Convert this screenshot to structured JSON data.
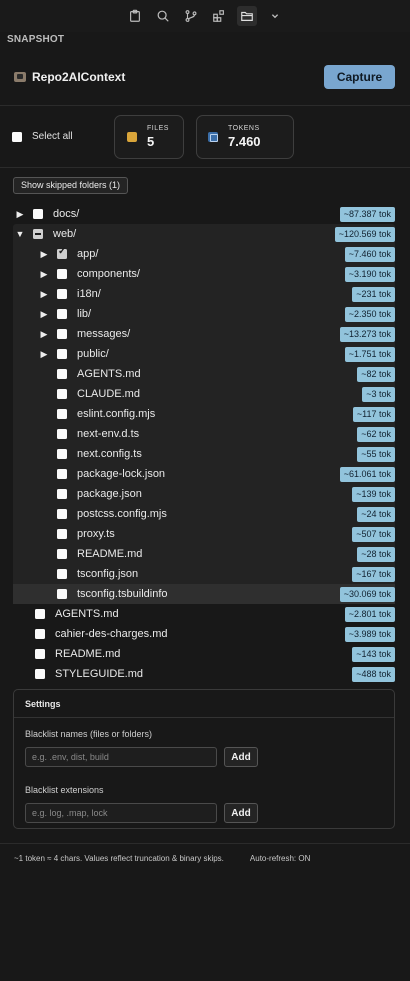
{
  "activity_bar": {
    "icons": [
      "clipboard-icon",
      "search-icon",
      "source-control-icon",
      "extensions-icon",
      "folder-panel-icon",
      "chevron-down-icon"
    ]
  },
  "section": {
    "title": "SNAPSHOT"
  },
  "header": {
    "app_name": "Repo2AIContext",
    "capture_label": "Capture"
  },
  "stats": {
    "select_all_label": "Select all",
    "files_label": "FILES",
    "files_value": "5",
    "tokens_label": "TOKENS",
    "tokens_value": "7.460"
  },
  "skip_button": "Show skipped folders (1)",
  "tree": {
    "top": [
      {
        "name": "docs/",
        "tokens": "~87.387 tok",
        "arrow": "▶",
        "state": "unchecked"
      }
    ],
    "web": {
      "name": "web/",
      "tokens": "~120.569 tok",
      "arrow": "▼",
      "state": "indeterminate"
    },
    "web_children": [
      {
        "name": "app/",
        "tokens": "~7.460 tok",
        "arrow": "▶",
        "state": "checked"
      },
      {
        "name": "components/",
        "tokens": "~3.190 tok",
        "arrow": "▶",
        "state": "unchecked"
      },
      {
        "name": "i18n/",
        "tokens": "~231 tok",
        "arrow": "▶",
        "state": "unchecked"
      },
      {
        "name": "lib/",
        "tokens": "~2.350 tok",
        "arrow": "▶",
        "state": "unchecked"
      },
      {
        "name": "messages/",
        "tokens": "~13.273 tok",
        "arrow": "▶",
        "state": "unchecked"
      },
      {
        "name": "public/",
        "tokens": "~1.751 tok",
        "arrow": "▶",
        "state": "unchecked"
      },
      {
        "name": "AGENTS.md",
        "tokens": "~82 tok",
        "arrow": "",
        "state": "unchecked"
      },
      {
        "name": "CLAUDE.md",
        "tokens": "~3 tok",
        "arrow": "",
        "state": "unchecked"
      },
      {
        "name": "eslint.config.mjs",
        "tokens": "~117 tok",
        "arrow": "",
        "state": "unchecked"
      },
      {
        "name": "next-env.d.ts",
        "tokens": "~62 tok",
        "arrow": "",
        "state": "unchecked"
      },
      {
        "name": "next.config.ts",
        "tokens": "~55 tok",
        "arrow": "",
        "state": "unchecked"
      },
      {
        "name": "package-lock.json",
        "tokens": "~61.061 tok",
        "arrow": "",
        "state": "unchecked"
      },
      {
        "name": "package.json",
        "tokens": "~139 tok",
        "arrow": "",
        "state": "unchecked"
      },
      {
        "name": "postcss.config.mjs",
        "tokens": "~24 tok",
        "arrow": "",
        "state": "unchecked"
      },
      {
        "name": "proxy.ts",
        "tokens": "~507 tok",
        "arrow": "",
        "state": "unchecked"
      },
      {
        "name": "README.md",
        "tokens": "~28 tok",
        "arrow": "",
        "state": "unchecked"
      },
      {
        "name": "tsconfig.json",
        "tokens": "~167 tok",
        "arrow": "",
        "state": "unchecked"
      },
      {
        "name": "tsconfig.tsbuildinfo",
        "tokens": "~30.069 tok",
        "arrow": "",
        "state": "unchecked",
        "hovered": true
      }
    ],
    "root_files": [
      {
        "name": "AGENTS.md",
        "tokens": "~2.801 tok",
        "state": "unchecked"
      },
      {
        "name": "cahier-des-charges.md",
        "tokens": "~3.989 tok",
        "state": "unchecked"
      },
      {
        "name": "README.md",
        "tokens": "~143 tok",
        "state": "unchecked"
      },
      {
        "name": "STYLEGUIDE.md",
        "tokens": "~488 tok",
        "state": "unchecked"
      }
    ]
  },
  "settings": {
    "title": "Settings",
    "blacklist_names_label": "Blacklist names (files or folders)",
    "blacklist_names_placeholder": "e.g. .env, dist, build",
    "blacklist_names_value": "",
    "blacklist_ext_label": "Blacklist extensions",
    "blacklist_ext_placeholder": "e.g. log, .map, lock",
    "blacklist_ext_value": "",
    "add_label": "Add"
  },
  "footer": {
    "note": "~1 token ≈ 4 chars. Values reflect truncation & binary skips.",
    "auto_refresh": "Auto-refresh: ON"
  },
  "colors": {
    "accent": "#79a6cf",
    "token_badge": "#92c4dc",
    "background": "#181818"
  }
}
